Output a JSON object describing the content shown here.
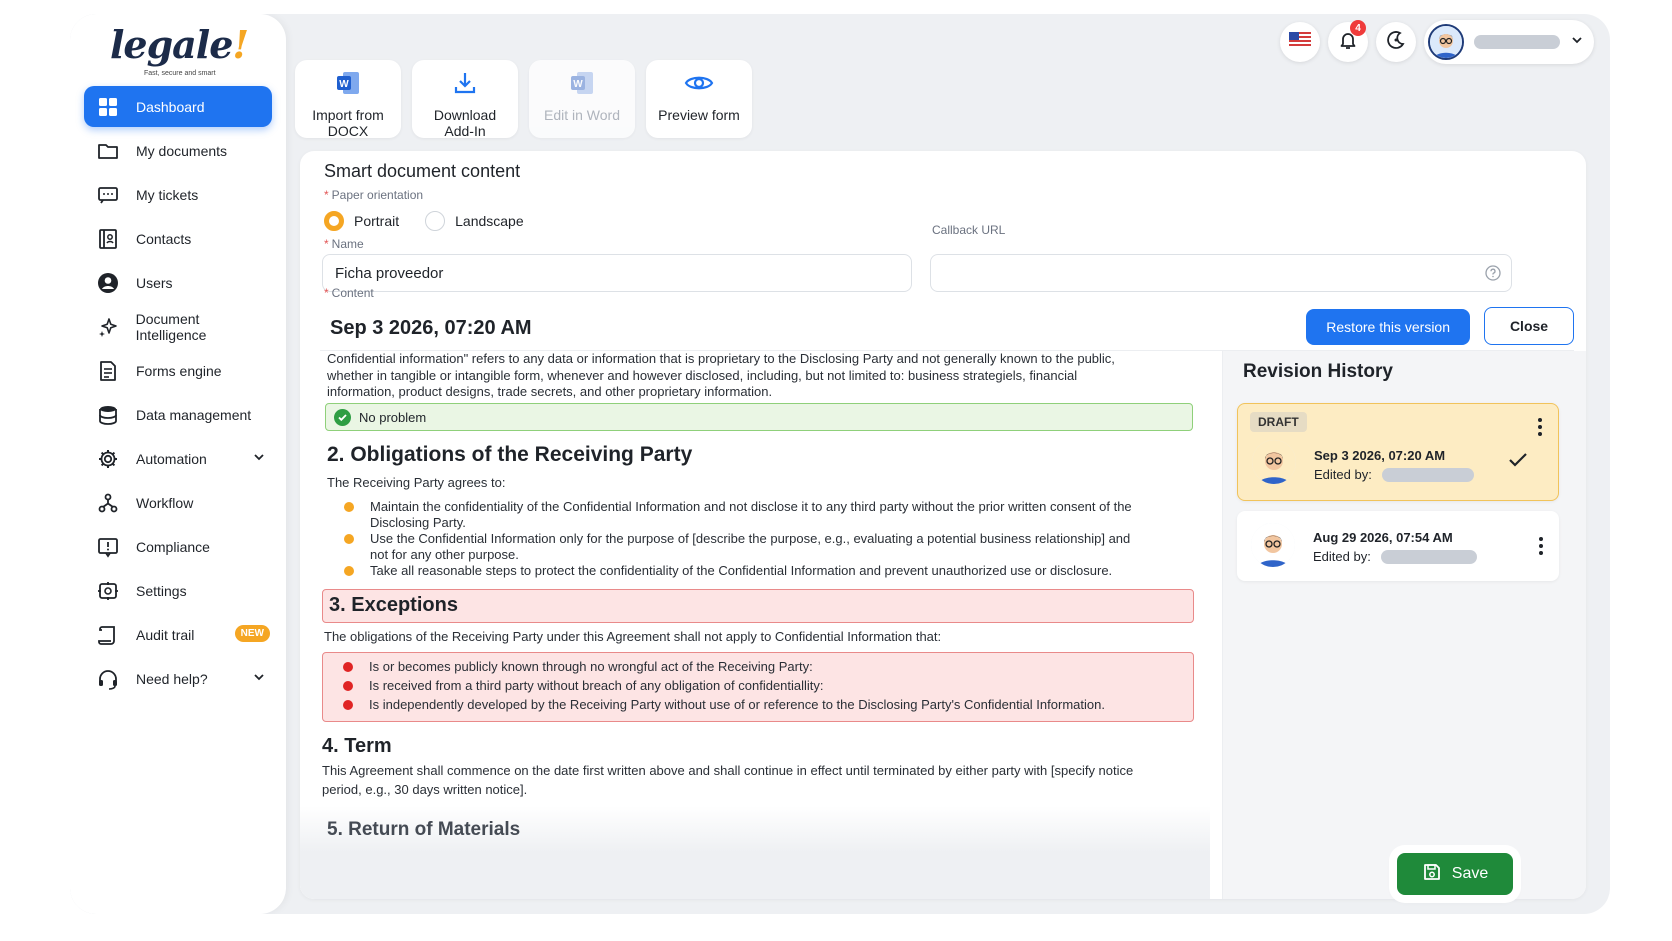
{
  "logo": {
    "text": "legale",
    "mark": "!",
    "tagline": "Fast, secure and smart"
  },
  "sidebar": {
    "items": [
      {
        "label": "Dashboard",
        "icon": "dashboard-icon"
      },
      {
        "label": "My documents",
        "icon": "folder-icon"
      },
      {
        "label": "My tickets",
        "icon": "ticket-icon"
      },
      {
        "label": "Contacts",
        "icon": "contacts-icon"
      },
      {
        "label": "Users",
        "icon": "user-icon"
      },
      {
        "label": "Document Intelligence",
        "icon": "sparkle-icon"
      },
      {
        "label": "Forms engine",
        "icon": "form-icon"
      },
      {
        "label": "Data management",
        "icon": "database-icon"
      },
      {
        "label": "Automation",
        "icon": "gear-icon"
      },
      {
        "label": "Workflow",
        "icon": "workflow-icon"
      },
      {
        "label": "Compliance",
        "icon": "compliance-icon"
      },
      {
        "label": "Settings",
        "icon": "settings-icon"
      },
      {
        "label": "Audit trail",
        "icon": "audit-icon"
      },
      {
        "label": "Need help?",
        "icon": "headset-icon"
      }
    ],
    "new_badge": "NEW"
  },
  "topbar": {
    "notifications_count": "4"
  },
  "toolbar": {
    "import_label": "Import from DOCX",
    "download_label": "Download Add-In",
    "edit_label": "Edit in Word",
    "preview_label": "Preview form"
  },
  "form": {
    "title": "Smart document content",
    "orientation_label": "Paper orientation",
    "portrait": "Portrait",
    "landscape": "Landscape",
    "name_label": "Name",
    "name_value": "Ficha proveedor",
    "callback_label": "Callback URL",
    "content_label": "Content"
  },
  "version": {
    "title": "Sep 3 2026, 07:20 AM",
    "restore_label": "Restore this version",
    "close_label": "Close"
  },
  "doc": {
    "intro": "Confidential information\" refers to any data or information that is proprietary to the Disclosing Party and not generally known to the public, whether in tangible or intangible form, whenever and however disclosed, including, but not limited to: business strategiels, financial information, product designs, trade secrets, and other proprietary information.",
    "no_problem": "No problem",
    "h2_title": "2. Obligations of the Receiving Party",
    "agrees": "The Receiving Party agrees to:",
    "obligations": [
      "Maintain the confidentiality of the Confidential Information and not disclose it to any third party without the prior written consent of the Disclosing Party.",
      "Use the Confidential Information only for the purpose of [describe the purpose, e.g., evaluating a potential business relationship] and not for any other purpose.",
      "Take all reasonable steps to protect the confidentiality of the Confidential Information and prevent unauthorized use or disclosure."
    ],
    "h3_title": "3. Exceptions",
    "exceptions_intro": "The obligations of the Receiving Party under this Agreement shall not apply to Confidential Information that:",
    "exceptions": [
      "Is or becomes publicly known through no wrongful act of the Receiving Party:",
      "Is received from a third party without breach of any obligation of confidentiallity:",
      "Is independently developed by the Receiving Party without use of or reference to the Disclosing Party's Confidential Information."
    ],
    "h4_title": "4. Term",
    "term_text": "This Agreement shall commence on the date first written above and shall continue in effect until terminated by either party with [specify notice period, e.g., 30 days written notice].",
    "h5_title": "5. Return of Materials"
  },
  "revisions": {
    "title": "Revision History",
    "items": [
      {
        "tag": "DRAFT",
        "date": "Sep 3 2026, 07:20 AM",
        "by": "Edited by:"
      },
      {
        "date": "Aug 29 2026, 07:54 AM",
        "by": "Edited by:"
      }
    ]
  },
  "save_label": "Save",
  "colors": {
    "primary": "#1f74f0",
    "accent": "#f5a623",
    "success": "#1f8a3a",
    "danger": "#e25555"
  }
}
